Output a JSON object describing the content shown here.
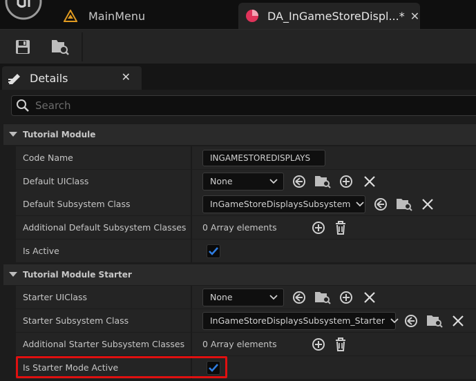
{
  "tabs": {
    "main_menu": "MainMenu",
    "data_asset": "DA_InGameStoreDispl...*"
  },
  "details": {
    "title": "Details"
  },
  "search": {
    "placeholder": "Search"
  },
  "sections": [
    {
      "title": "Tutorial Module",
      "rows": [
        {
          "label": "Code Name",
          "value": "INGAMESTOREDISPLAYS"
        },
        {
          "label": "Default UIClass",
          "value": "None"
        },
        {
          "label": "Default Subsystem Class",
          "value": "InGameStoreDisplaysSubsystem"
        },
        {
          "label": "Additional Default Subsystem Classes",
          "value": "0 Array elements"
        },
        {
          "label": "Is Active",
          "value": true
        }
      ]
    },
    {
      "title": "Tutorial Module Starter",
      "rows": [
        {
          "label": "Starter UIClass",
          "value": "None"
        },
        {
          "label": "Starter Subsystem Class",
          "value": "InGameStoreDisplaysSubsystem_Starter"
        },
        {
          "label": "Additional Starter Subsystem Classes",
          "value": "0 Array elements"
        },
        {
          "label": "Is Starter Mode Active",
          "value": true
        }
      ]
    }
  ],
  "colors": {
    "accent_check": "#2f7de1",
    "highlight_box": "#e01010",
    "data_asset_icon": "#e0335a",
    "level_icon": "#e09a20"
  }
}
